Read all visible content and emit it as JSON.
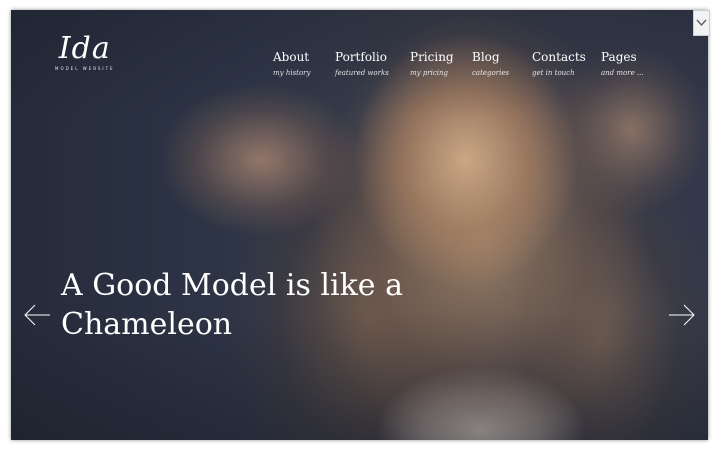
{
  "brand": {
    "logo_text": "Ida",
    "tagline": "MODEL WEBSITE"
  },
  "nav": {
    "items": [
      {
        "label": "About",
        "sub": "my history"
      },
      {
        "label": "Portfolio",
        "sub": "featured works"
      },
      {
        "label": "Pricing",
        "sub": "my pricing"
      },
      {
        "label": "Blog",
        "sub": "categories"
      },
      {
        "label": "Contacts",
        "sub": "get in touch"
      },
      {
        "label": "Pages",
        "sub": "and more ..."
      }
    ]
  },
  "hero": {
    "headline_line1": "A Good Model is like a",
    "headline_line2": "Chameleon",
    "icons": {
      "prev": "arrow-left-icon",
      "next": "arrow-right-icon",
      "scroll": "chevron-down-icon"
    }
  },
  "colors": {
    "text": "#ffffff",
    "background": "#2b3242"
  }
}
